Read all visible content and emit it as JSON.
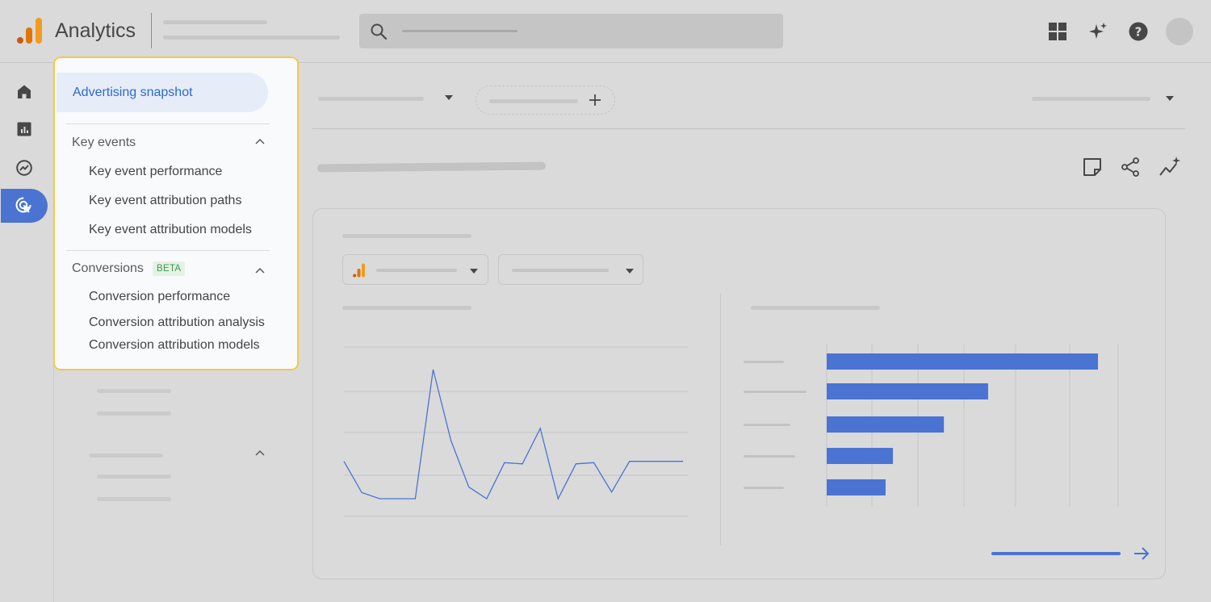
{
  "header": {
    "app_title": "Analytics",
    "icons": [
      "apps-grid-icon",
      "sparkle-icon",
      "help-icon"
    ],
    "logo_colors": [
      "#f29c1f",
      "#e37400",
      "#c75b13"
    ]
  },
  "rail": {
    "items": [
      "home-icon",
      "reports-icon",
      "explore-icon",
      "advertising-icon"
    ],
    "active_index": 3,
    "accent_color": "#4a73d2"
  },
  "nav_popup": {
    "snapshot_label": "Advertising snapshot",
    "key_events": {
      "title": "Key events",
      "items": [
        "Key event performance",
        "Key event attribution paths",
        "Key event attribution models"
      ]
    },
    "conversions": {
      "title": "Conversions",
      "badge": "BETA",
      "items": [
        "Conversion performance",
        "Conversion attribution analysis",
        "Conversion attribution models"
      ]
    },
    "highlight_color": "#f4c84a"
  },
  "toolbar": {
    "icons": [
      "note-icon",
      "share-icon",
      "insights-icon"
    ]
  },
  "chart_data": [
    {
      "type": "line",
      "x": [
        1,
        2,
        3,
        4,
        5,
        6,
        7,
        8,
        9,
        10,
        11,
        12,
        13,
        14,
        15,
        16,
        17,
        18,
        19,
        20
      ],
      "values": [
        3.0,
        0.45,
        -0.05,
        -0.05,
        -0.05,
        10.5,
        4.7,
        0.9,
        -0.05,
        2.9,
        2.8,
        5.7,
        -0.05,
        2.8,
        2.9,
        0.5,
        3.0,
        3.0,
        3.0,
        3.0
      ],
      "line_color": "#4a73d2",
      "grid": true
    },
    {
      "type": "bar",
      "orientation": "horizontal",
      "values": [
        100,
        59.5,
        43.2,
        24.4,
        21.7
      ],
      "bar_color": "#4a73d2",
      "grid": true
    }
  ]
}
